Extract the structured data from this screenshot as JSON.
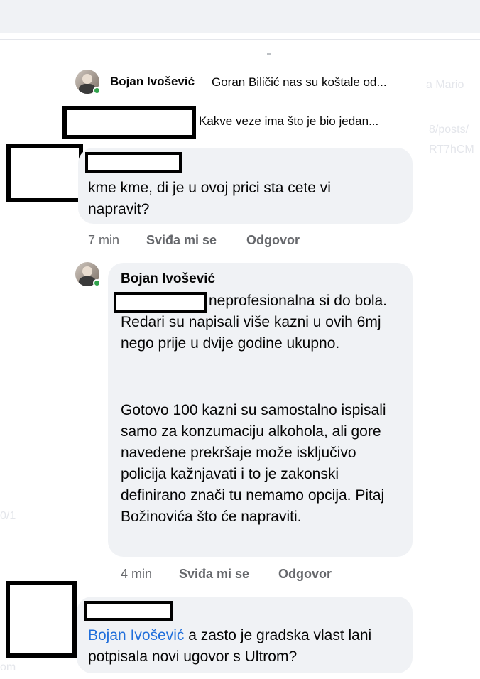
{
  "thread": {
    "collapsed_reply": {
      "author": "Bojan Ivošević",
      "preview": "Goran Biličić nas su koštale od..."
    },
    "collapsed_reply_2": {
      "preview": "Kakve veze ima što je bio jedan..."
    },
    "comment1": {
      "text": "kme kme, di je u ovoj prici sta cete vi napravit?",
      "time": "7 min",
      "like_label": "Sviđa mi se",
      "reply_label": "Odgovor"
    },
    "comment2": {
      "author": "Bojan Ivošević",
      "para1": "neprofesionalna si do bola. Redari su napisali više kazni u ovih 6mj nego prije u dvije godine ukupno.",
      "para2": "Gotovo 100 kazni su samostalno ispisali samo za konzumaciju alkohola, ali gore navedene prekršaje može isključivo policija kažnjavati i to je zakonski definirano znači tu nemamo opcija. Pitaj Božinovića što će napraviti.",
      "time": "4 min",
      "like_label": "Sviđa mi se",
      "reply_label": "Odgovor"
    },
    "comment3": {
      "mention": "Bojan Ivošević",
      "text": " a zasto je gradska vlast lani potpisala novi ugovor s Ultrom?"
    }
  },
  "background_ghost_text": {
    "right1": "a Mario",
    "right2": "8/posts/",
    "right3": "RT7hCM",
    "left1": "0/1",
    "left2": "om"
  },
  "colors": {
    "bubble": "#f0f2f5",
    "link": "#216fdb",
    "meta": "#65676b",
    "online": "#31a24c"
  }
}
